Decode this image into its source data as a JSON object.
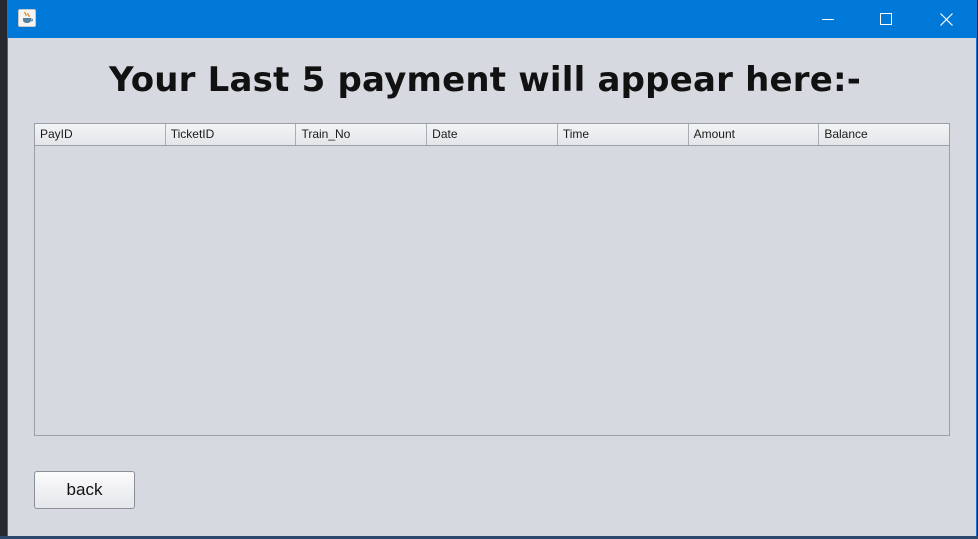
{
  "window": {
    "title": "",
    "icon": "java-coffee-cup-icon",
    "controls": {
      "minimize_icon": "minimize-icon",
      "maximize_icon": "maximize-icon",
      "close_icon": "close-icon"
    },
    "titlebar_color": "#0078d7"
  },
  "heading": "Your Last 5 payment will appear here:-",
  "table": {
    "columns": [
      "PayID",
      "TicketID",
      "Train_No",
      "Date",
      "Time",
      "Amount",
      "Balance"
    ],
    "rows": []
  },
  "buttons": {
    "back_label": "back"
  }
}
